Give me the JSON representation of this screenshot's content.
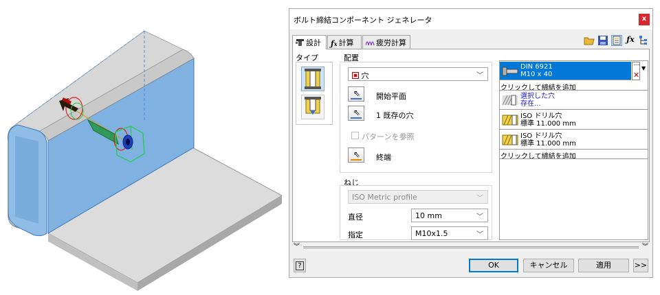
{
  "dialog": {
    "title": "ボルト締結コンポーネント ジェネレータ",
    "close_label": "x"
  },
  "tabs": [
    {
      "label": "設計"
    },
    {
      "label": "計算"
    },
    {
      "label": "疲労計算"
    }
  ],
  "design": {
    "type_label": "タイプ",
    "placement_label": "配置",
    "placement_value": "穴",
    "start_plane_label": "開始平面",
    "existing_hole_label": "1 既存の穴",
    "pattern_label": "パターンを参照",
    "termination_label": "終端",
    "thread_label": "ねじ",
    "thread_type_value": "ISO Metric profile",
    "diameter_label": "直径",
    "diameter_value": "10 mm",
    "designation_label": "指定",
    "designation_value": "M10x1.5"
  },
  "fastener_list": {
    "selected": {
      "line1": "DIN 6921",
      "line2": "M10 x 40"
    },
    "add_label_top": "クリックして締結を追加",
    "items": [
      {
        "line1": "選択した穴",
        "line2": "存在..."
      },
      {
        "line1": "ISO ドリル穴",
        "line2": "標準 11.000 mm"
      },
      {
        "line1": "ISO ドリル穴",
        "line2": "標準 11.000 mm"
      }
    ],
    "add_label_bottom": "クリックして締結を追加"
  },
  "footer": {
    "help_label": "?",
    "ok_label": "OK",
    "cancel_label": "キャンセル",
    "apply_label": "適用",
    "more_label": ">>"
  },
  "colors": {
    "selection": "#0078d7",
    "close": "#d8282f",
    "model_face": "#7fb2e0"
  }
}
